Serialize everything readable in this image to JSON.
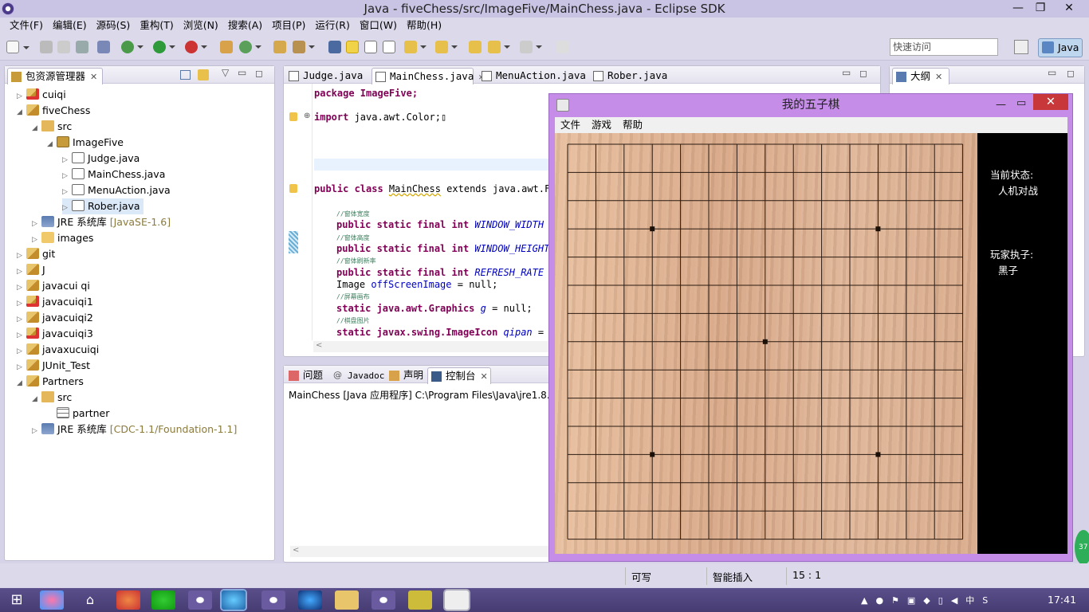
{
  "window": {
    "title": "Java - fiveChess/src/ImageFive/MainChess.java - Eclipse SDK",
    "min": "—",
    "max": "❐",
    "close": "✕"
  },
  "menubar": [
    "文件(F)",
    "编辑(E)",
    "源码(S)",
    "重构(T)",
    "浏览(N)",
    "搜索(A)",
    "项目(P)",
    "运行(R)",
    "窗口(W)",
    "帮助(H)"
  ],
  "toolbar": {
    "quick_access_placeholder": "快速访问",
    "perspective_label": "Java"
  },
  "package_explorer": {
    "tab_label": "包资源管理器",
    "items": [
      {
        "label": "cuiqi",
        "type": "projerr",
        "level": 0,
        "arrow": "▷"
      },
      {
        "label": "fiveChess",
        "type": "proj",
        "level": 0,
        "arrow": "◢"
      },
      {
        "label": "src",
        "type": "src",
        "level": 1,
        "arrow": "◢"
      },
      {
        "label": "ImageFive",
        "type": "pkg",
        "level": 2,
        "arrow": "◢"
      },
      {
        "label": "Judge.java",
        "type": "java",
        "level": 3,
        "arrow": "▷"
      },
      {
        "label": "MainChess.java",
        "type": "java",
        "level": 3,
        "arrow": "▷"
      },
      {
        "label": "MenuAction.java",
        "type": "java",
        "level": 3,
        "arrow": "▷"
      },
      {
        "label": "Rober.java",
        "type": "java",
        "level": 3,
        "arrow": "▷"
      },
      {
        "label": "JRE 系统库",
        "deco": "[JavaSE-1.6]",
        "type": "jar",
        "level": 1,
        "arrow": "▷"
      },
      {
        "label": "images",
        "type": "folder",
        "level": 1,
        "arrow": "▷"
      },
      {
        "label": "git",
        "type": "proj",
        "level": 0,
        "arrow": "▷"
      },
      {
        "label": "J",
        "type": "proj",
        "level": 0,
        "arrow": "▷"
      },
      {
        "label": "javacui qi",
        "type": "proj",
        "level": 0,
        "arrow": "▷"
      },
      {
        "label": "javacuiqi1",
        "type": "projerr",
        "level": 0,
        "arrow": "▷"
      },
      {
        "label": "javacuiqi2",
        "type": "proj",
        "level": 0,
        "arrow": "▷"
      },
      {
        "label": "javacuiqi3",
        "type": "projerr",
        "level": 0,
        "arrow": "▷"
      },
      {
        "label": "javaxucuiqi",
        "type": "proj",
        "level": 0,
        "arrow": "▷"
      },
      {
        "label": "JUnit_Test",
        "type": "proj",
        "level": 0,
        "arrow": "▷"
      },
      {
        "label": "Partners",
        "type": "proj",
        "level": 0,
        "arrow": "◢"
      },
      {
        "label": "src",
        "type": "src",
        "level": 1,
        "arrow": "◢"
      },
      {
        "label": "partner",
        "type": "grid",
        "level": 2,
        "arrow": ""
      },
      {
        "label": "JRE 系统库",
        "deco": "[CDC-1.1/Foundation-1.1]",
        "type": "jar",
        "level": 1,
        "arrow": "▷"
      }
    ]
  },
  "editor": {
    "tabs": [
      "Judge.java",
      "MainChess.java",
      "MenuAction.java",
      "Rober.java"
    ],
    "active_tab": 1,
    "lines": {
      "l1": "package ImageFive;",
      "l2": "import java.awt.Color;",
      "l3a": "public class ",
      "l3b": "MainChess",
      "l3c": " extends java.awt.Fr",
      "c1": "//窗体宽度",
      "l4a": "public static final int ",
      "l4b": "WINDOW_WIDTH",
      "l4c": " =",
      "c2": "//窗体高度",
      "l5a": "public static final int ",
      "l5b": "WINDOW_HEIGHT",
      "c3": "//窗体刷新率",
      "l6a": "public static final int ",
      "l6b": "REFRESH_RATE",
      "l6c": " =",
      "l7a": "Image ",
      "l7b": "offScreenImage",
      "l7c": " = null;",
      "c4": "//屏幕画布",
      "l8a": "static java.awt.Graphics ",
      "l8b": "g",
      "l8c": " = null;",
      "c5": "//棋盘图片",
      "l9a": "static javax.swing.ImageIcon ",
      "l9b": "qipan",
      "l9c": " = n"
    }
  },
  "console": {
    "tabs": [
      "问题",
      "Javadoc",
      "声明",
      "控制台"
    ],
    "active_tab": 3,
    "output": "MainChess [Java 应用程序] C:\\Program Files\\Java\\jre1.8.0"
  },
  "outline": {
    "tab_label": "大纲"
  },
  "game": {
    "title": "我的五子棋",
    "menu": [
      "文件",
      "游戏",
      "帮助"
    ],
    "status_label": "当前状态:",
    "status_value": "人机对战",
    "player_label": "玩家执子:",
    "player_value": "黑子",
    "board_lines": 15
  },
  "statusbar": {
    "writable": "可写",
    "insert": "智能插入",
    "position": "15 : 1"
  },
  "taskbar": {
    "clock": "17:41",
    "badge": "37"
  }
}
